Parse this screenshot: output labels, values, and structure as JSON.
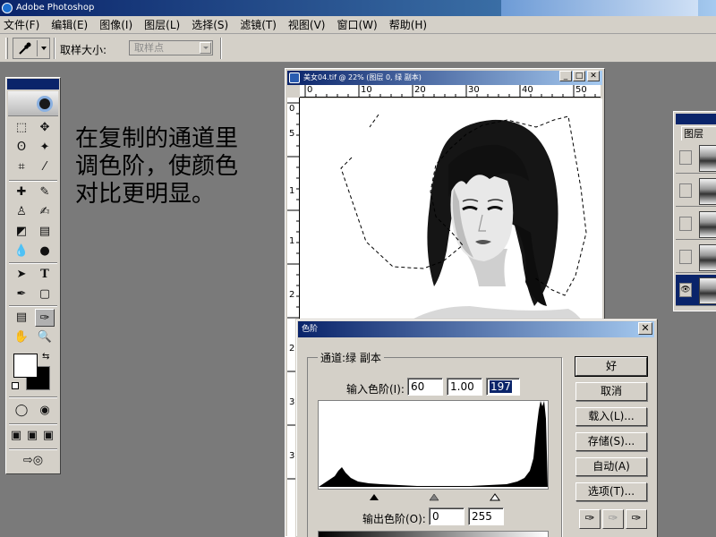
{
  "app": {
    "title": "Adobe Photoshop"
  },
  "menu": [
    "文件(F)",
    "编辑(E)",
    "图像(I)",
    "图层(L)",
    "选择(S)",
    "滤镜(T)",
    "视图(V)",
    "窗口(W)",
    "帮助(H)"
  ],
  "options": {
    "sample_size_label": "取样大小:",
    "sample_size_value": "取样点"
  },
  "toolbox": {
    "tools": [
      "marquee-tool",
      "move-tool",
      "lasso-tool",
      "magic-wand-tool",
      "crop-tool",
      "slice-tool",
      "healing-brush-tool",
      "brush-tool",
      "clone-stamp-tool",
      "history-brush-tool",
      "eraser-tool",
      "gradient-tool",
      "blur-tool",
      "dodge-tool",
      "path-selection-tool",
      "type-tool",
      "pen-tool",
      "shape-tool",
      "notes-tool",
      "eyedropper-tool",
      "hand-tool",
      "zoom-tool"
    ],
    "active_tool": "eyedropper-tool",
    "foreground_color": "#ffffff",
    "background_color": "#000000"
  },
  "annotation": {
    "lines": [
      "在复制的通道里",
      "调色阶，使颜色",
      "对比更明显。"
    ]
  },
  "document": {
    "title": "美女04.tif @ 22% (图层 0, 绿 副本)",
    "ruler_top": [
      "0",
      "10",
      "20",
      "30",
      "40",
      "50"
    ],
    "ruler_left": [
      "0",
      "5",
      "1",
      "1",
      "2",
      "2",
      "3",
      "3"
    ]
  },
  "levels_dialog": {
    "title": "色阶",
    "channel_label": "通道:",
    "channel_value": "绿 副本",
    "input_levels_label": "输入色阶(I):",
    "input_black": "60",
    "input_gamma": "1.00",
    "input_white": "197",
    "output_levels_label": "输出色阶(O):",
    "output_black": "0",
    "output_white": "255",
    "buttons": {
      "ok": "好",
      "cancel": "取消",
      "load": "载入(L)...",
      "save": "存储(S)...",
      "auto": "自动(A)",
      "options": "选项(T)..."
    }
  },
  "layers_panel": {
    "tab_label": "图层",
    "layer_count": 5,
    "active_layer_index": 4
  }
}
